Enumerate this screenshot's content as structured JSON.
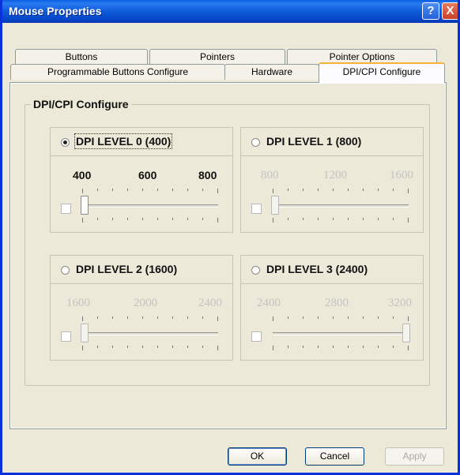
{
  "window": {
    "title": "Mouse Properties"
  },
  "titlebar": {
    "help_label": "?",
    "close_label": "X"
  },
  "tabs": {
    "row1": [
      "Buttons",
      "Pointers",
      "Pointer Options"
    ],
    "row2": [
      "Programmable Buttons Configure",
      "Hardware",
      "DPI/CPI Configure"
    ],
    "active": "DPI/CPI Configure"
  },
  "group": {
    "label": "DPI/CPI Configure"
  },
  "levels": [
    {
      "label": "DPI LEVEL 0 (400)",
      "selected": true,
      "scale": [
        "400",
        "600",
        "800"
      ],
      "enabled": true,
      "slider_position": 0,
      "checkbox_checked": false
    },
    {
      "label": "DPI LEVEL 1 (800)",
      "selected": false,
      "scale": [
        "800",
        "1200",
        "1600"
      ],
      "enabled": false,
      "slider_position": 0,
      "checkbox_checked": false
    },
    {
      "label": "DPI LEVEL 2 (1600)",
      "selected": false,
      "scale": [
        "1600",
        "2000",
        "2400"
      ],
      "enabled": false,
      "slider_position": 0,
      "checkbox_checked": false
    },
    {
      "label": "DPI LEVEL 3 (2400)",
      "selected": false,
      "scale": [
        "2400",
        "2800",
        "3200"
      ],
      "enabled": false,
      "slider_position": 1,
      "checkbox_checked": false
    }
  ],
  "buttons": {
    "ok": "OK",
    "cancel": "Cancel",
    "apply": "Apply"
  },
  "colors": {
    "title_bar": "#0a5ee0",
    "active_tab_accent": "#f5b13a",
    "face": "#ece9d8"
  }
}
